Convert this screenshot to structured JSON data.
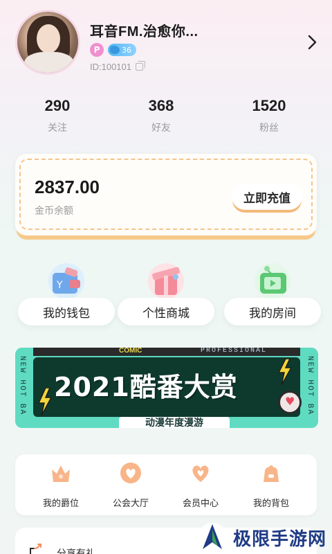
{
  "profile": {
    "nickname": "耳音FM.治愈你...",
    "badge_p": "P",
    "level": "36",
    "user_id": "ID:100101"
  },
  "stats": [
    {
      "value": "290",
      "label": "关注"
    },
    {
      "value": "368",
      "label": "好友"
    },
    {
      "value": "1520",
      "label": "粉丝"
    }
  ],
  "wallet": {
    "balance": "2837.00",
    "balance_label": "金币余额",
    "recharge_label": "立即充值"
  },
  "entries": [
    {
      "label": "我的钱包",
      "icon": "wallet-icon"
    },
    {
      "label": "个性商城",
      "icon": "gift-box-icon"
    },
    {
      "label": "我的房间",
      "icon": "tv-icon"
    }
  ],
  "banner": {
    "title": "2021酷番大赏",
    "subtitle": "动漫年度漫游",
    "top_left_text": "COMIC",
    "top_right_text": "PROFESSIONAL",
    "side_text": "NEW HOT BA"
  },
  "quick_links": [
    {
      "label": "我的爵位",
      "icon": "crown-icon"
    },
    {
      "label": "公会大厅",
      "icon": "guild-icon"
    },
    {
      "label": "会员中心",
      "icon": "heart-icon"
    },
    {
      "label": "我的背包",
      "icon": "bag-icon"
    }
  ],
  "share": {
    "label": "分享有礼"
  },
  "watermark": {
    "text": "极限手游网"
  },
  "colors": {
    "accent_orange": "#f6c38a",
    "banner_teal": "#5fdbc2",
    "level_blue": "#57b7f2"
  }
}
